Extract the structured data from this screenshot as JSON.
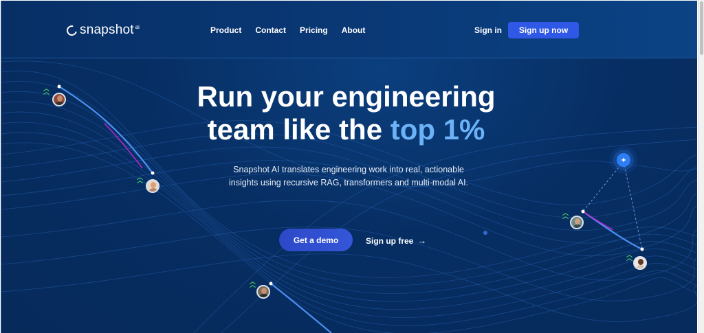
{
  "header": {
    "logo_text": "snapshot",
    "logo_suffix": "ai",
    "nav": [
      "Product",
      "Contact",
      "Pricing",
      "About"
    ],
    "sign_in": "Sign in",
    "sign_up": "Sign up now"
  },
  "hero": {
    "title_part1": "Run your engineering",
    "title_part2": "team like the ",
    "title_highlight": "top 1%",
    "subtitle": "Snapshot AI translates engineering work into real, actionable insights using recursive RAG, transformers and multi-modal AI.",
    "cta_demo": "Get a demo",
    "cta_free": "Sign up free"
  },
  "colors": {
    "background": "#072e63",
    "accent_button": "#2f58e6",
    "highlight_text": "#6cb2f7",
    "rank_up": "#4cd964"
  },
  "icons": [
    "chevron-double-up-icon",
    "sparkle-icon",
    "arrow-right-icon"
  ]
}
